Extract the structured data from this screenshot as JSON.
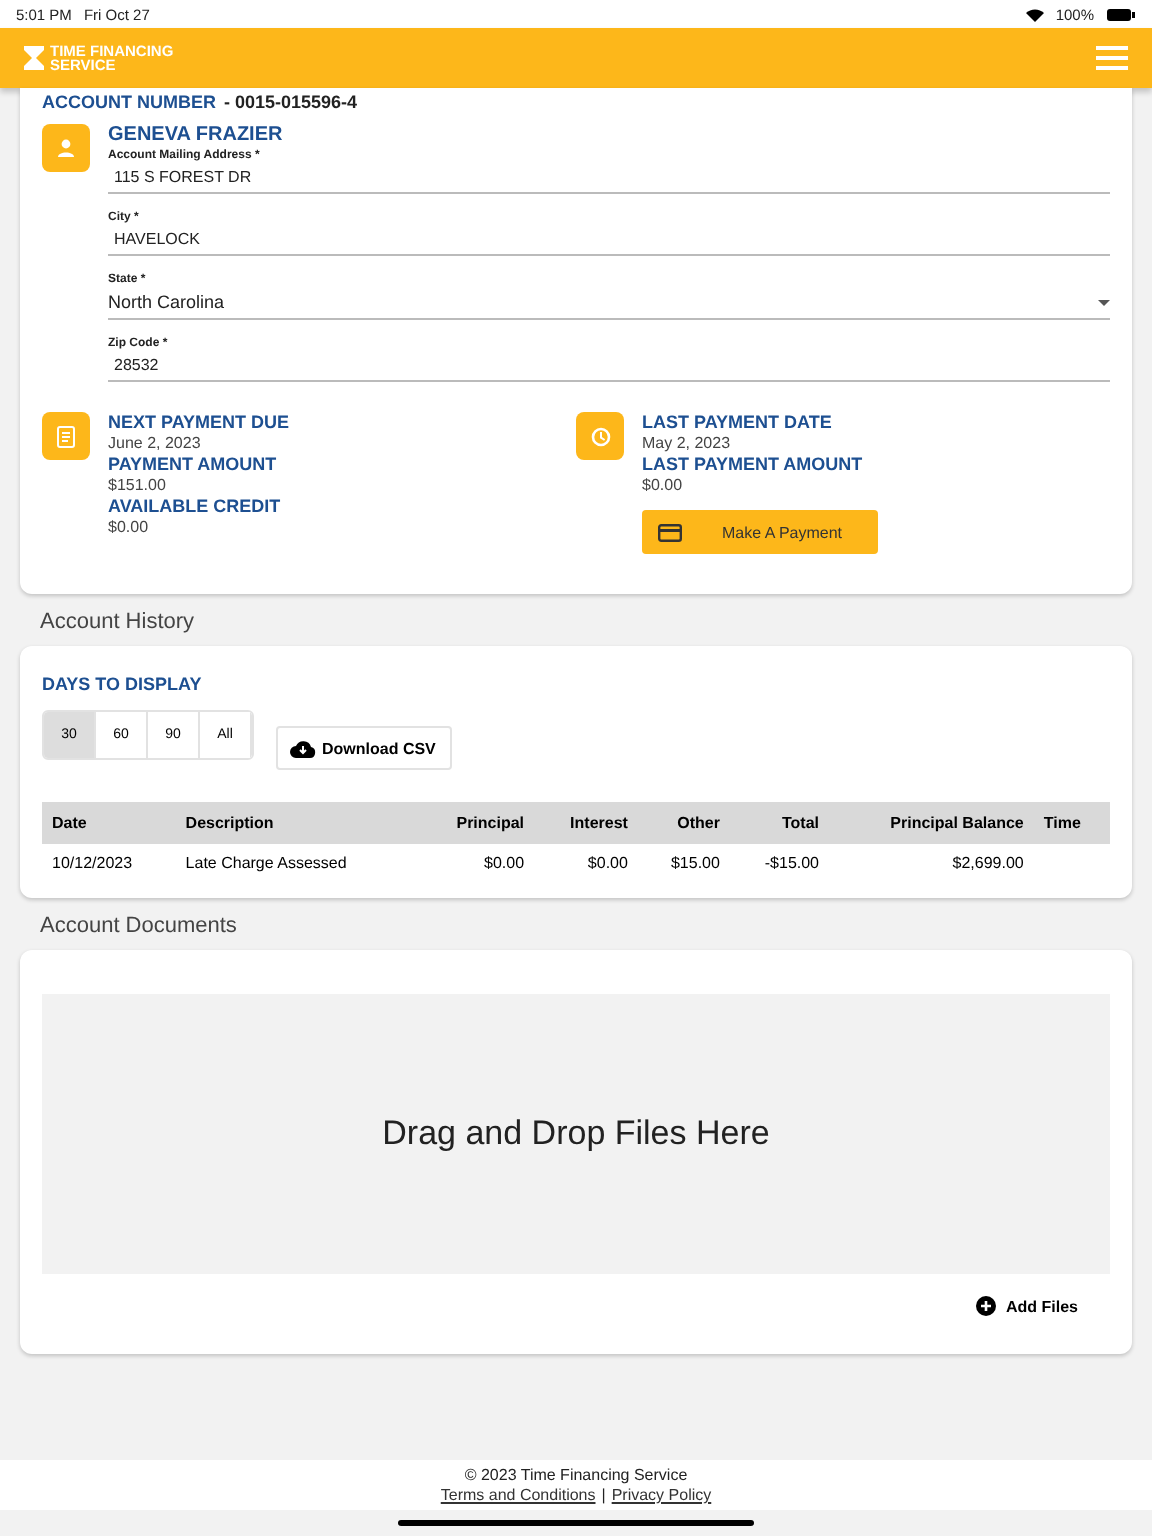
{
  "status_bar": {
    "time": "5:01 PM",
    "date": "Fri Oct 27",
    "battery": "100%"
  },
  "header": {
    "logo_line_1": "TIME FINANCING",
    "logo_line_2": "SERVICE"
  },
  "account": {
    "label": "ACCOUNT NUMBER",
    "number": "- 0015-015596-4",
    "name": "GENEVA FRAZIER",
    "fields": [
      {
        "kind": "text",
        "label": "Account Mailing Address *",
        "value": "115 S FOREST DR"
      },
      {
        "kind": "text",
        "label": "City *",
        "value": "HAVELOCK"
      },
      {
        "kind": "select",
        "label": "State *",
        "value": "North Carolina"
      },
      {
        "kind": "text",
        "label": "Zip Code *",
        "value": "28532"
      }
    ]
  },
  "payments": {
    "left": [
      {
        "label": "NEXT PAYMENT DUE",
        "value": "June 2, 2023"
      },
      {
        "label": "PAYMENT AMOUNT",
        "value": "$151.00"
      },
      {
        "label": "AVAILABLE CREDIT",
        "value": "$0.00"
      }
    ],
    "right": [
      {
        "label": "LAST PAYMENT DATE",
        "value": "May 2, 2023"
      },
      {
        "label": "LAST PAYMENT AMOUNT",
        "value": "$0.00"
      }
    ],
    "button": "Make A Payment"
  },
  "history": {
    "title": "Account History",
    "days_label": "DAYS TO DISPLAY",
    "days": [
      {
        "label": "30",
        "selected": true
      },
      {
        "label": "60",
        "selected": false
      },
      {
        "label": "90",
        "selected": false
      },
      {
        "label": "All",
        "selected": false
      }
    ],
    "download": "Download CSV",
    "columns": [
      "Date",
      "Description",
      "Principal",
      "Interest",
      "Other",
      "Total",
      "Principal Balance",
      "Time"
    ],
    "rows": [
      [
        "10/12/2023",
        "Late Charge Assessed",
        "$0.00",
        "$0.00",
        "$15.00",
        "-$15.00",
        "$2,699.00",
        ""
      ]
    ]
  },
  "documents": {
    "title": "Account Documents",
    "drop_text": "Drag and Drop Files Here",
    "add": "Add Files"
  },
  "footer": {
    "copyright": "© 2023 Time Financing Service",
    "terms": "Terms and Conditions",
    "separator": "|",
    "privacy": "Privacy Policy"
  }
}
